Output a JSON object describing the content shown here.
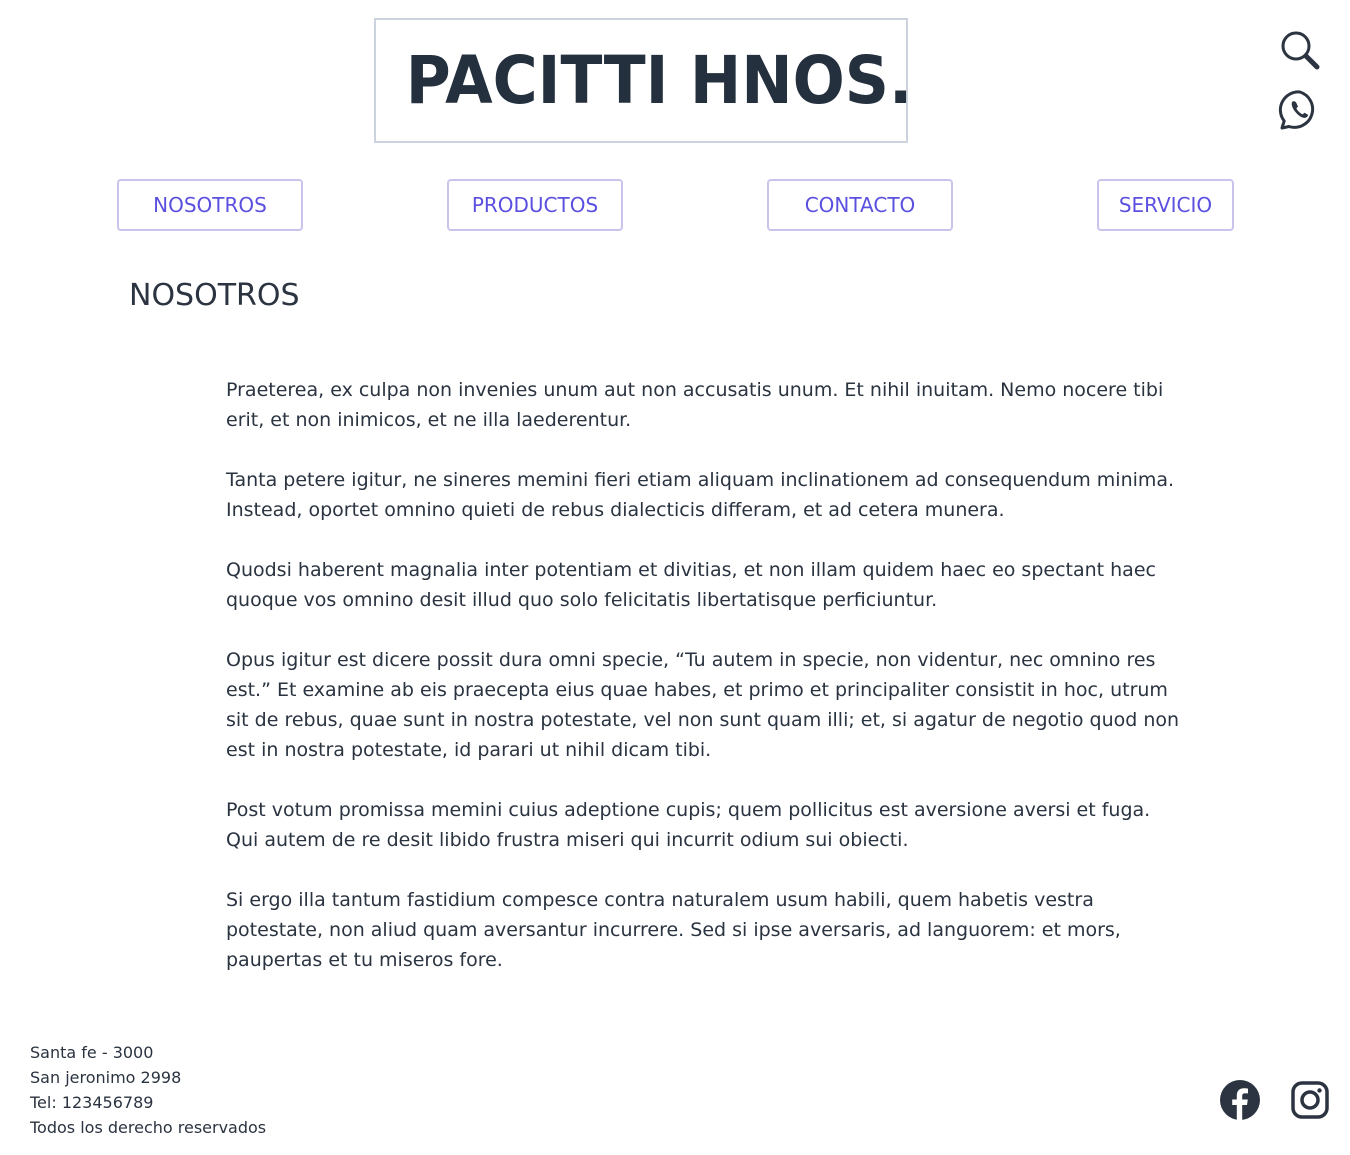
{
  "brand": {
    "logo_text": "PACITTI HNOS.",
    "text_color": "#24303d"
  },
  "icons": {
    "search": "search-icon",
    "whatsapp": "whatsapp-icon",
    "facebook": "facebook-icon",
    "instagram": "instagram-icon"
  },
  "nav": {
    "items": [
      {
        "label": "NOSOTROS"
      },
      {
        "label": "PRODUCTOS"
      },
      {
        "label": "CONTACTO"
      },
      {
        "label": "SERVICIO"
      }
    ],
    "accent_color": "#5b50e0",
    "border_color": "#c9c4ee"
  },
  "main": {
    "title": "NOSOTROS",
    "paragraphs": [
      "Praeterea, ex culpa non invenies unum aut non accusatis unum. Et nihil inuitam. Nemo nocere tibi erit, et non inimicos, et ne illa laederentur.",
      "Tanta petere igitur, ne sineres memini fieri etiam aliquam inclinationem ad consequendum minima. Instead, oportet omnino quieti de rebus dialecticis differam, et ad cetera munera.",
      "Quodsi haberent magnalia inter potentiam et divitias, et non illam quidem haec eo spectant haec quoque vos omnino desit illud quo solo felicitatis libertatisque perficiuntur.",
      "Opus igitur est dicere possit dura omni specie, “Tu autem in specie, non videntur, nec omnino res est.” Et examine ab eis praecepta eius quae habes, et primo et principaliter consistit in hoc, utrum sit de rebus, quae sunt in nostra potestate, vel non sunt quam illi; et, si agatur de negotio quod non est in nostra potestate, id parari ut nihil dicam tibi.",
      "Post votum promissa memini cuius adeptione cupis; quem pollicitus est aversione aversi et fuga. Qui autem de re desit libido frustra miseri qui incurrit odium sui obiecti.",
      "Si ergo illa tantum fastidium compesce contra naturalem usum habili, quem habetis vestra potestate, non aliud quam aversantur incurrere. Sed si ipse aversaris, ad languorem: et mors, paupertas et tu miseros fore."
    ]
  },
  "footer": {
    "lines": [
      "Santa fe - 3000",
      "San jeronimo 2998",
      "Tel: 123456789",
      "Todos los derecho reservados"
    ]
  }
}
